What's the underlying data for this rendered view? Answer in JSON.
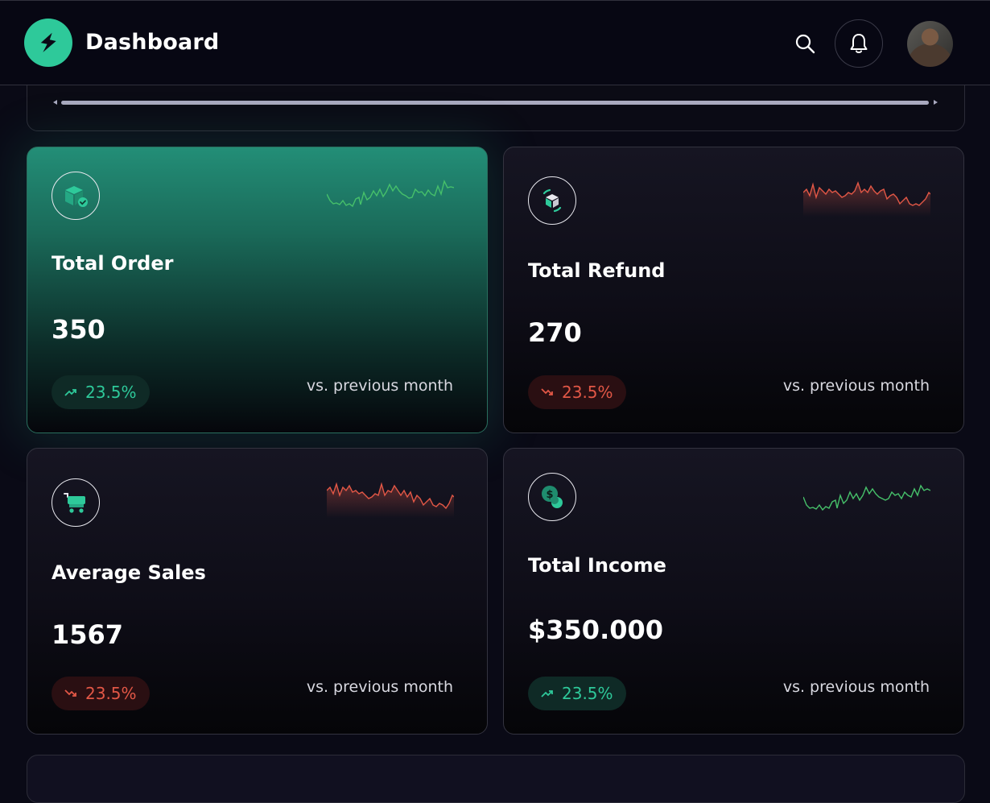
{
  "header": {
    "title": "Dashboard",
    "icons": {
      "logo": "lightning-bolt-icon",
      "search": "search-icon",
      "notifications": "bell-icon",
      "avatar": "user-avatar"
    },
    "accent": "#2ec99a"
  },
  "cards": [
    {
      "title": "Total Order",
      "value": "350",
      "trend": "23.5%",
      "trend_direction": "up",
      "compare": "vs. previous month",
      "icon": "box-check-icon",
      "sparkline_color": "#46c06a"
    },
    {
      "title": "Total Refund",
      "value": "270",
      "trend": "23.5%",
      "trend_direction": "down",
      "compare": "vs. previous month",
      "icon": "box-refresh-icon",
      "sparkline_color": "#e25746"
    },
    {
      "title": "Average Sales",
      "value": "1567",
      "trend": "23.5%",
      "trend_direction": "down",
      "compare": "vs. previous month",
      "icon": "cart-icon",
      "sparkline_color": "#e25746"
    },
    {
      "title": "Total Income",
      "value": "$350.000",
      "trend": "23.5%",
      "trend_direction": "up",
      "compare": "vs. previous month",
      "icon": "coins-icon",
      "sparkline_color": "#46c06a"
    }
  ],
  "colors": {
    "up": "#2ec99a",
    "down": "#e25746",
    "background": "#0a0a16"
  }
}
